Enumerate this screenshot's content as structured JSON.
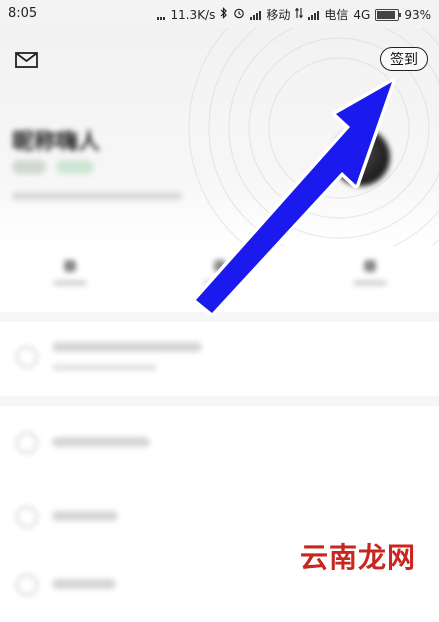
{
  "status_bar": {
    "time": "8:05",
    "net_speed": "11.3K/s",
    "carrier1": "移动",
    "carrier2": "电信",
    "network": "4G",
    "battery_text": "93%",
    "battery_level": 0.93
  },
  "header": {
    "mail_icon": "envelope-icon",
    "checkin_label": "签到"
  },
  "profile": {
    "username": "昵称嗨人"
  },
  "overlay": {
    "arrow_color": "#1a1aee",
    "arrow_outline": "#ffffff"
  },
  "watermark": {
    "text": "云南龙网",
    "color": "#c8261e"
  }
}
